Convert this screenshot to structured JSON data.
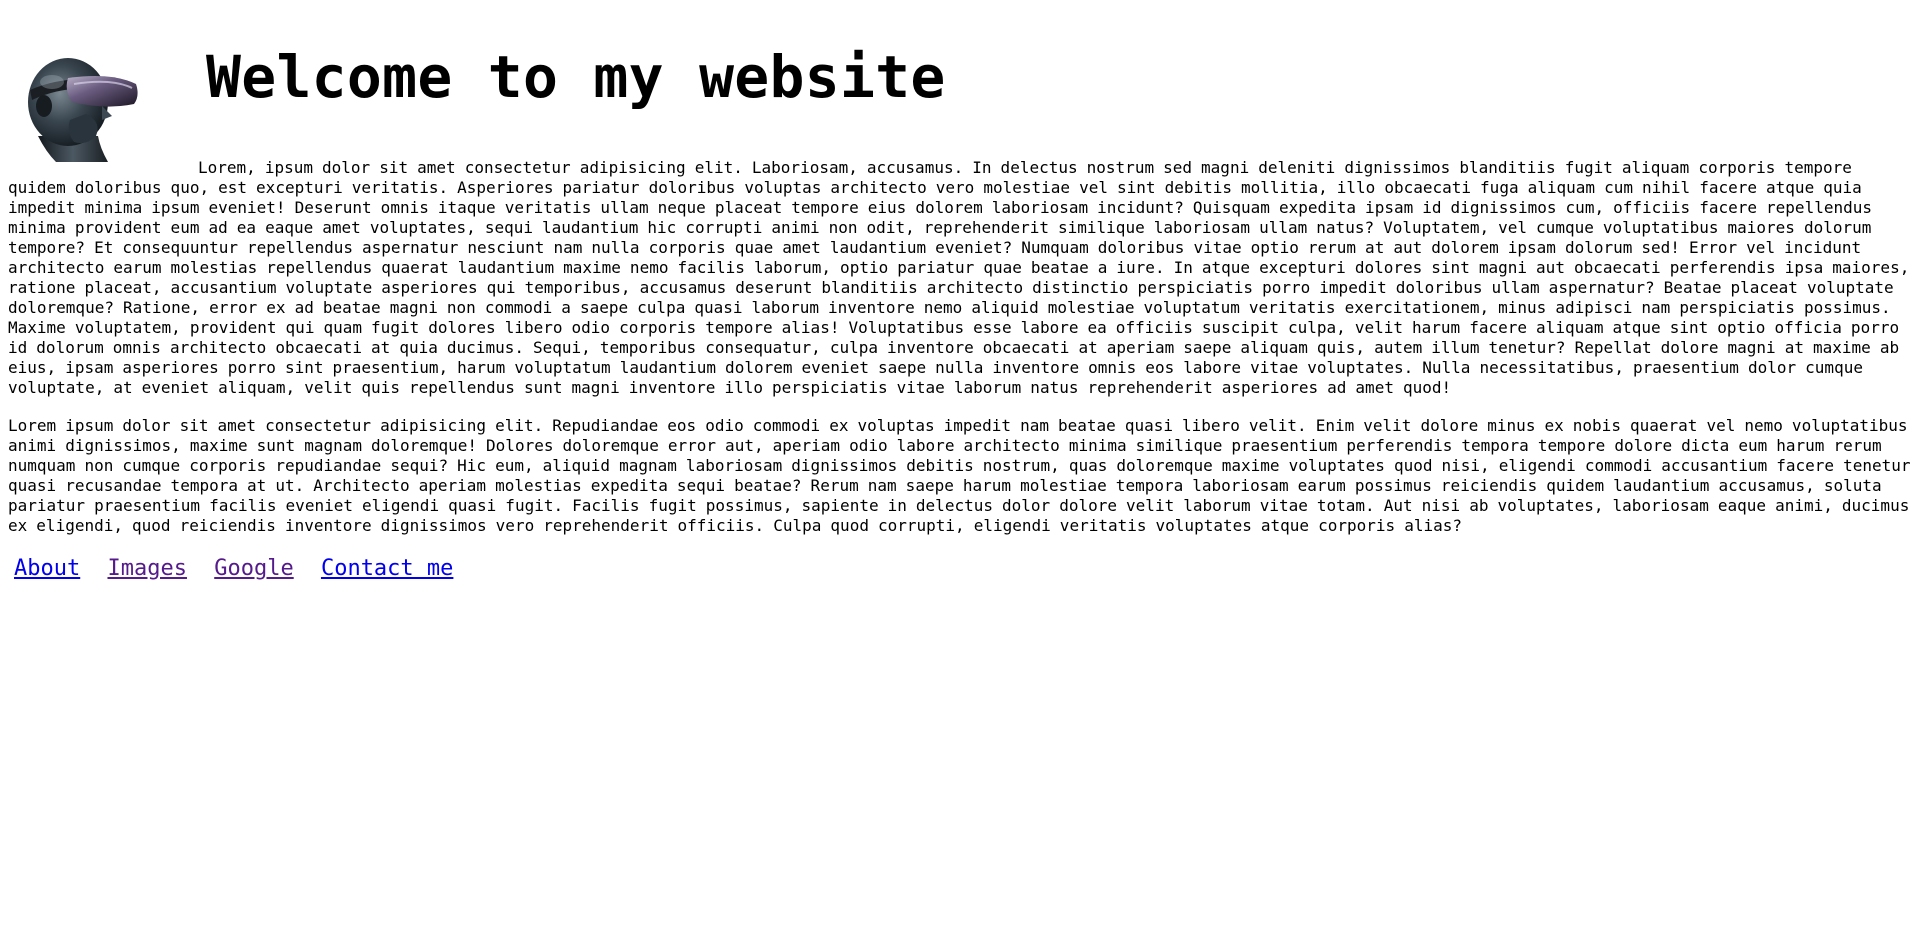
{
  "header": {
    "title": "Welcome to my website",
    "avatar_icon": "vr-headset-bust-icon"
  },
  "content": {
    "paragraph_1": "Lorem, ipsum dolor sit amet consectetur adipisicing elit. Laboriosam, accusamus. In delectus nostrum sed magni deleniti dignissimos blanditiis fugit aliquam corporis tempore quidem doloribus quo, est excepturi veritatis. Asperiores pariatur doloribus voluptas architecto vero molestiae vel sint debitis mollitia, illo obcaecati fuga aliquam cum nihil facere atque quia impedit minima ipsum eveniet! Deserunt omnis itaque veritatis ullam neque placeat tempore eius dolorem laboriosam incidunt? Quisquam expedita ipsam id dignissimos cum, officiis facere repellendus minima provident eum ad ea eaque amet voluptates, sequi laudantium hic corrupti animi non odit, reprehenderit similique laboriosam ullam natus? Voluptatem, vel cumque voluptatibus maiores dolorum tempore? Et consequuntur repellendus aspernatur nesciunt nam nulla corporis quae amet laudantium eveniet? Numquam doloribus vitae optio rerum at aut dolorem ipsam dolorum sed! Error vel incidunt architecto earum molestias repellendus quaerat laudantium maxime nemo facilis laborum, optio pariatur quae beatae a iure. In atque excepturi dolores sint magni aut obcaecati perferendis ipsa maiores, ratione placeat, accusantium voluptate asperiores qui temporibus, accusamus deserunt blanditiis architecto distinctio perspiciatis porro impedit doloribus ullam aspernatur? Beatae placeat voluptate doloremque? Ratione, error ex ad beatae magni non commodi a saepe culpa quasi laborum inventore nemo aliquid molestiae voluptatum veritatis exercitationem, minus adipisci nam perspiciatis possimus. Maxime voluptatem, provident qui quam fugit dolores libero odio corporis tempore alias! Voluptatibus esse labore ea officiis suscipit culpa, velit harum facere aliquam atque sint optio officia porro id dolorum omnis architecto obcaecati at quia ducimus. Sequi, temporibus consequatur, culpa inventore obcaecati at aperiam saepe aliquam quis, autem illum tenetur? Repellat dolore magni at maxime ab eius, ipsam asperiores porro sint praesentium, harum voluptatum laudantium dolorem eveniet saepe nulla inventore omnis eos labore vitae voluptates. Nulla necessitatibus, praesentium dolor cumque voluptate, at eveniet aliquam, velit quis repellendus sunt magni inventore illo perspiciatis vitae laborum natus reprehenderit asperiores ad amet quod!",
    "paragraph_2": "Lorem ipsum dolor sit amet consectetur adipisicing elit. Repudiandae eos odio commodi ex voluptas impedit nam beatae quasi libero velit. Enim velit dolore minus ex nobis quaerat vel nemo voluptatibus animi dignissimos, maxime sunt magnam doloremque! Dolores doloremque error aut, aperiam odio labore architecto minima similique praesentium perferendis tempora tempore dolore dicta eum harum rerum numquam non cumque corporis repudiandae sequi? Hic eum, aliquid magnam laboriosam dignissimos debitis nostrum, quas doloremque maxime voluptates quod nisi, eligendi commodi accusantium facere tenetur quasi recusandae tempora at ut. Architecto aperiam molestias expedita sequi beatae? Rerum nam saepe harum molestiae tempora laboriosam earum possimus reiciendis quidem laudantium accusamus, soluta pariatur praesentium facilis eveniet eligendi quasi fugit. Facilis fugit possimus, sapiente in delectus dolor dolore velit laborum vitae totam. Aut nisi ab voluptates, laboriosam eaque animi, ducimus ex eligendi, quod reiciendis inventore dignissimos vero reprehenderit officiis. Culpa quod corrupti, eligendi veritatis voluptates atque corporis alias?"
  },
  "nav": {
    "links": [
      {
        "label": "About",
        "visited": false
      },
      {
        "label": "Images",
        "visited": true
      },
      {
        "label": "Google",
        "visited": true
      },
      {
        "label": "Contact me",
        "visited": false
      }
    ]
  },
  "colors": {
    "link": "#0000ee",
    "visited_link": "#551a8b",
    "text": "#000000",
    "background": "#ffffff"
  }
}
